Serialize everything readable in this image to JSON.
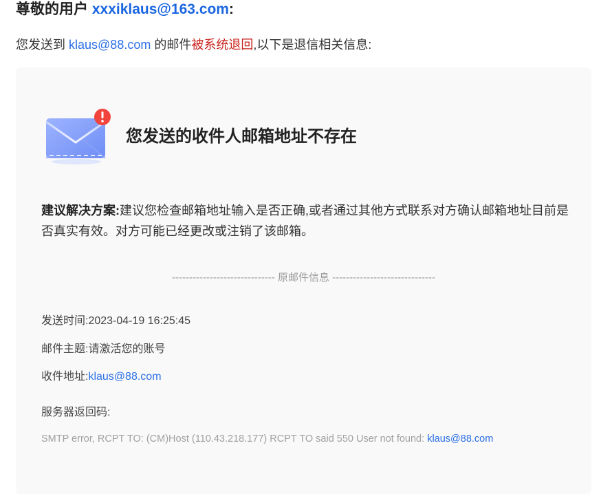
{
  "greeting": {
    "prefix": "尊敬的用户",
    "address": "xxxiklaus@163.com",
    "suffix": ":"
  },
  "intro": {
    "part1": "您发送到",
    "recipient": "klaus@88.com",
    "part2": "的邮件",
    "highlight": "被系统退回",
    "part3": ",以下是退信相关信息:"
  },
  "card": {
    "icon": "envelope-alert-icon",
    "title": "您发送的收件人邮箱地址不存在",
    "suggestion_label": "建议解决方案:",
    "suggestion_text": "建议您检查邮箱地址输入是否正确,或者通过其他方式联系对方确认邮箱地址目前是否真实有效。对方可能已经更改或注销了该邮箱。",
    "divider": "------------------------------ 原邮件信息 ------------------------------",
    "send_time_label": "发送时间:",
    "send_time_value": "2023-04-19 16:25:45",
    "subject_label": "邮件主题:",
    "subject_value": "请激活您的账号",
    "address_label": "收件地址:",
    "address_value": "klaus@88.com",
    "server_code_label": "服务器返回码:",
    "smtp_text": "SMTP error, RCPT TO: (CM)Host (110.43.218.177) RCPT TO said 550 User not found: ",
    "smtp_addr": "klaus@88.com"
  },
  "colors": {
    "link": "#2b6fe6",
    "alert_red": "#c8201a",
    "card_bg": "#f9f9f9",
    "badge_red": "#f0443c"
  }
}
